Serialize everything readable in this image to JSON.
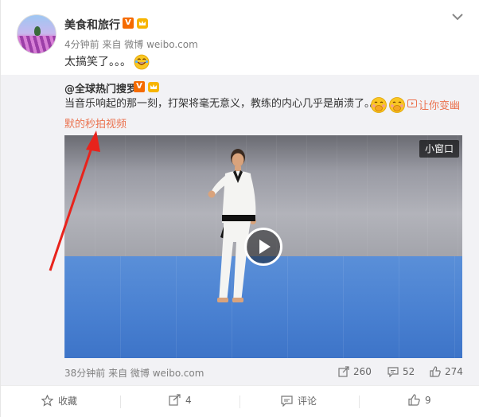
{
  "post": {
    "author": "美食和旅行",
    "verified_badge": "V",
    "time_source": "4分钟前 来自 微博 weibo.com",
    "text": "太搞笑了。。。"
  },
  "repost": {
    "author": "@全球热门搜罗",
    "verified_badge": "V",
    "text": "当音乐响起的那一刻，打架将毫无意义，教练的内心几乎是崩溃了。。。",
    "link_line1": "让你变幽",
    "link_line2": "默的秒拍视频",
    "video": {
      "mini_window_label": "小窗口"
    },
    "time_source": "38分钟前 来自 微博 weibo.com",
    "stats": {
      "reposts": "260",
      "comments": "52",
      "likes": "274"
    }
  },
  "actions": {
    "favorite": "收藏",
    "repost": "4",
    "comment": "评论",
    "like": "9"
  },
  "colors": {
    "link": "#eb7350",
    "verified": "#f56b00",
    "annotation_arrow": "#e8231c"
  }
}
